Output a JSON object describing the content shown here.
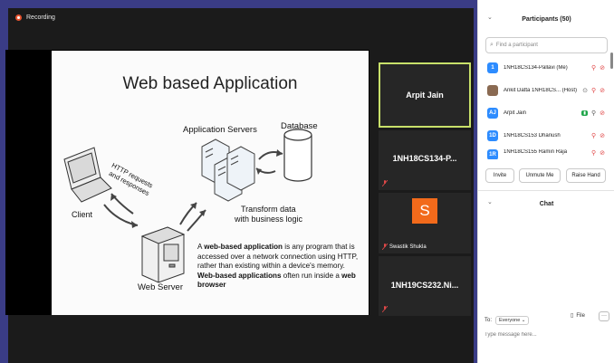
{
  "meeting": {
    "recording_label": "Recording"
  },
  "slide": {
    "title": "Web based Application",
    "labels": {
      "app_servers": "Application Servers",
      "database": "Database",
      "http_line1": "HTTP requests",
      "http_line2": "and responses",
      "client": "Client",
      "transform_line1": "Transform data",
      "transform_line2": "with business logic",
      "web_server": "Web Server"
    },
    "desc": {
      "p1": "A ",
      "b1": "web-based application",
      "p2": " is any program that is accessed over a network connection using HTTP, rather than existing within a device's memory. ",
      "b2": "Web-based applications",
      "p3": " often run inside a ",
      "b3": "web browser"
    }
  },
  "tiles": [
    {
      "name": "Arpit Jain"
    },
    {
      "name": "1NH18CS134-P..."
    },
    {
      "name": "Swastik Shukla",
      "initial": "S"
    },
    {
      "name": "1NH19CS232.Ni..."
    }
  ],
  "participants": {
    "header": "Participants (50)",
    "search_placeholder": "Find a participant",
    "list": [
      {
        "avatar": "1",
        "name": "1NH18CS134-Pallavi (Me)",
        "color": "#2d8cff"
      },
      {
        "avatar": "",
        "name": "Ankit Datta 1NH18CS... (Host)",
        "color": "#8a6a52"
      },
      {
        "avatar": "AJ",
        "name": "Arpit Jain",
        "color": "#2d8cff"
      },
      {
        "avatar": "1D",
        "name": "1NH18CS153 Dhanush",
        "color": "#2d8cff"
      },
      {
        "avatar": "1R",
        "name": "1NH18CS155 Ramin Raja",
        "color": "#2d8cff"
      }
    ],
    "buttons": {
      "invite": "Invite",
      "unmute": "Unmute Me",
      "raise": "Raise Hand"
    }
  },
  "chat": {
    "header": "Chat",
    "to_label": "To:",
    "to_value": "Everyone",
    "file_label": "File",
    "more_label": "···",
    "placeholder": "Type message here..."
  },
  "colors": {
    "accent_blue": "#2d8cff",
    "speaking_border": "#c8e06a",
    "muted_red": "#e04848",
    "tile_orange": "#f26a1b",
    "frame_purple": "#3a3c86"
  }
}
